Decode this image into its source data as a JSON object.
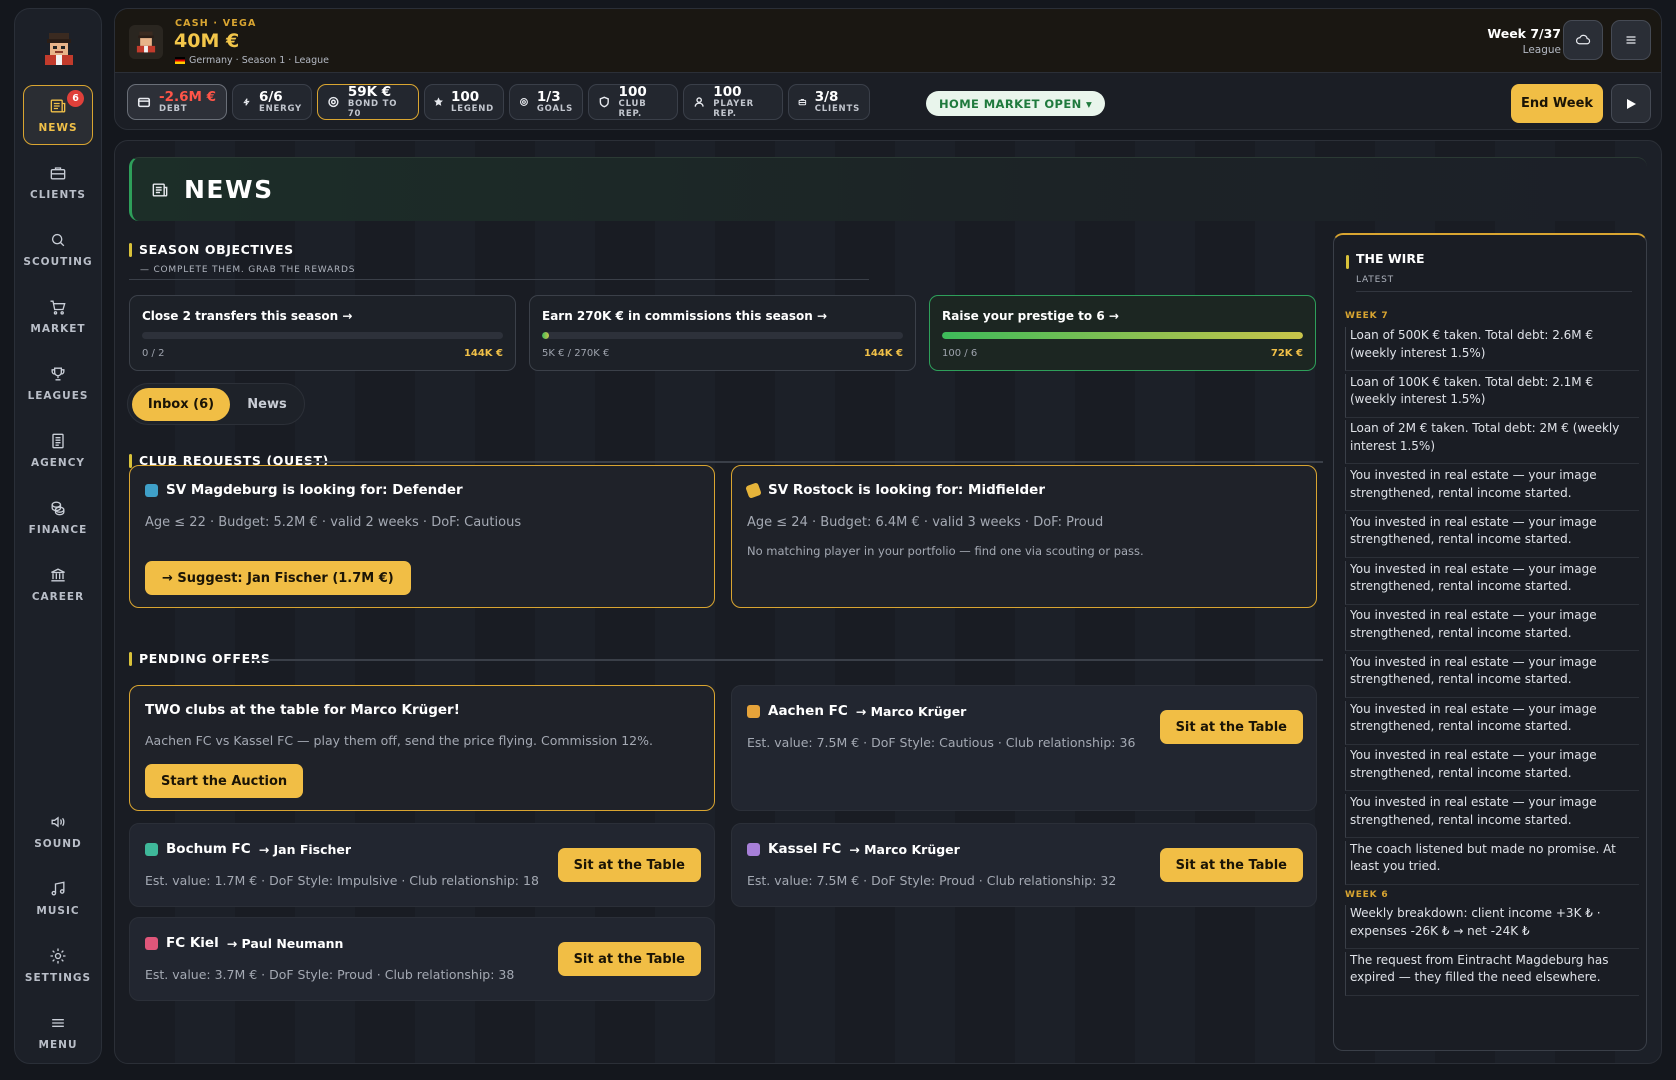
{
  "sidebar": {
    "items": [
      {
        "label": "NEWS",
        "badge": "6"
      },
      {
        "label": "CLIENTS"
      },
      {
        "label": "SCOUTING"
      },
      {
        "label": "MARKET"
      },
      {
        "label": "LEAGUES"
      },
      {
        "label": "AGENCY"
      },
      {
        "label": "FINANCE"
      },
      {
        "label": "CAREER"
      }
    ],
    "bottom": [
      {
        "label": "SOUND"
      },
      {
        "label": "MUSIC"
      },
      {
        "label": "SETTINGS"
      },
      {
        "label": "MENU"
      }
    ]
  },
  "header": {
    "cash_label": "CASH · VEGA",
    "cash_value": "40M €",
    "subtitle": "Germany · Season 1 · League",
    "week": "Week 7/37",
    "week_sub": "League"
  },
  "stats": [
    {
      "value": "-2.6M €",
      "label": "DEBT",
      "icon": "wallet-icon"
    },
    {
      "value": "6/6",
      "label": "ENERGY",
      "icon": "bolt-icon"
    },
    {
      "value": "59K €",
      "label": "BOND TO 70",
      "icon": "target-icon"
    },
    {
      "value": "100",
      "label": "LEGEND",
      "icon": "star-icon"
    },
    {
      "value": "1/3",
      "label": "GOALS",
      "icon": "target-icon"
    },
    {
      "value": "100",
      "label": "CLUB REP.",
      "icon": "shield-icon"
    },
    {
      "value": "100",
      "label": "PLAYER REP.",
      "icon": "user-icon"
    },
    {
      "value": "3/8",
      "label": "CLIENTS",
      "icon": "briefcase-icon"
    }
  ],
  "market_status": "HOME MARKET OPEN ▾",
  "end_week": "End Week",
  "page_title": "NEWS",
  "objectives": {
    "title": "SEASON OBJECTIVES",
    "subtitle": "— COMPLETE THEM. GRAB THE REWARDS",
    "items": [
      {
        "text": "Close 2 transfers this season →",
        "progress_text": "0 / 2",
        "reward": "144K €",
        "progress": 0.0
      },
      {
        "text": "Earn 270K € in commissions this season →",
        "progress_text": "5K € / 270K €",
        "reward": "144K €",
        "progress": 0.02
      },
      {
        "text": "Raise your prestige to 6 →",
        "progress_text": "100 / 6",
        "reward": "72K €",
        "progress": 1.0
      }
    ]
  },
  "tabs": {
    "inbox": "Inbox (6)",
    "news": "News"
  },
  "club_requests": {
    "title": "CLUB REQUESTS (QUEST)",
    "items": [
      {
        "title": "SV Magdeburg is looking for: Defender",
        "details": "Age ≤ 22 · Budget: 5.2M € · valid 2 weeks · DoF: Cautious",
        "action": "→ Suggest: Jan Fischer (1.7M €)",
        "color": "#3fa0c8"
      },
      {
        "title": "SV Rostock is looking for: Midfielder",
        "details": "Age ≤ 24 · Budget: 6.4M € · valid 3 weeks · DoF: Proud",
        "note": "No matching player in your portfolio — find one via scouting or pass.",
        "color": "#e6b43a"
      }
    ]
  },
  "pending_offers": {
    "title": "PENDING OFFERS",
    "auction": {
      "title": "TWO clubs at the table for Marco Krüger!",
      "details": "Aachen FC vs Kassel FC — play them off, send the price flying. Commission 12%.",
      "action": "Start the Auction"
    },
    "offers": [
      {
        "club": "Aachen FC",
        "player": "→ Marco Krüger",
        "details": "Est. value: 7.5M € · DoF Style: Cautious · Club relationship: 36",
        "action": "Sit at the Table",
        "color": "#e6a33a"
      },
      {
        "club": "Bochum FC",
        "player": "→ Jan Fischer",
        "details": "Est. value: 1.7M € · DoF Style: Impulsive · Club relationship: 18",
        "action": "Sit at the Table",
        "color": "#3fb89a"
      },
      {
        "club": "Kassel FC",
        "player": "→ Marco Krüger",
        "details": "Est. value: 7.5M € · DoF Style: Proud · Club relationship: 32",
        "action": "Sit at the Table",
        "color": "#a77fd8"
      },
      {
        "club": "FC Kiel",
        "player": "→ Paul Neumann",
        "details": "Est. value: 3.7M € · DoF Style: Proud · Club relationship: 38",
        "action": "Sit at the Table",
        "color": "#e0567a"
      }
    ]
  },
  "wire": {
    "title": "THE WIRE",
    "subtitle": "LATEST",
    "week7": "WEEK 7",
    "week6": "WEEK 6",
    "items": [
      "Loan of 500K € taken. Total debt: 2.6M € (weekly interest 1.5%)",
      "Loan of 100K € taken. Total debt: 2.1M € (weekly interest 1.5%)",
      "Loan of 2M € taken. Total debt: 2M € (weekly interest 1.5%)",
      "You invested in real estate — your image strengthened, rental income started.",
      "You invested in real estate — your image strengthened, rental income started.",
      "You invested in real estate — your image strengthened, rental income started.",
      "You invested in real estate — your image strengthened, rental income started.",
      "You invested in real estate — your image strengthened, rental income started.",
      "You invested in real estate — your image strengthened, rental income started.",
      "You invested in real estate — your image strengthened, rental income started.",
      "You invested in real estate — your image strengthened, rental income started.",
      "The coach listened but made no promise. At least you tried."
    ],
    "items_week6": [
      "Weekly breakdown: client income +3K ₺ · expenses -26K ₺ → net -24K ₺",
      "The request from Eintracht Magdeburg has expired — they filled the need elsewhere."
    ]
  }
}
